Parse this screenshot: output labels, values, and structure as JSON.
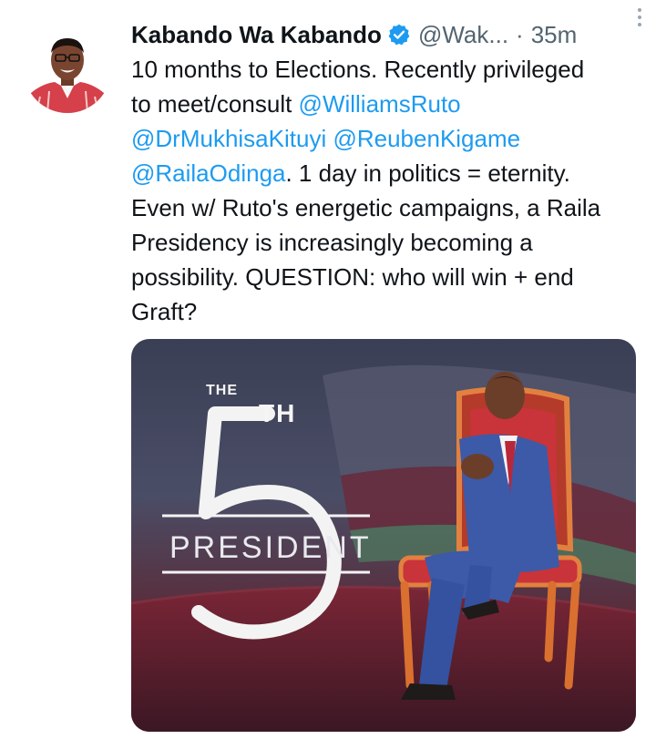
{
  "tweet": {
    "author_name": "Kabando Wa Kabando",
    "handle": "@Wak...",
    "separator": "·",
    "time": "35m",
    "text_lines": [
      {
        "parts": [
          {
            "t": "10 months to Elections. Recently privileged",
            "m": false
          }
        ]
      },
      {
        "parts": [
          {
            "t": "to meet/consult ",
            "m": false
          },
          {
            "t": "@WilliamsRuto",
            "m": true
          }
        ]
      },
      {
        "parts": [
          {
            "t": "@DrMukhisaKituyi",
            "m": true
          },
          {
            "t": "  ",
            "m": false
          },
          {
            "t": "@ReubenKigame",
            "m": true
          }
        ]
      },
      {
        "parts": [
          {
            "t": "@RailaOdinga",
            "m": true
          },
          {
            "t": ". 1 day in politics = eternity.",
            "m": false
          }
        ]
      },
      {
        "parts": [
          {
            "t": "Even w/ Ruto's energetic campaigns, a Raila",
            "m": false
          }
        ]
      },
      {
        "parts": [
          {
            "t": "Presidency is increasingly becoming a",
            "m": false
          }
        ]
      },
      {
        "parts": [
          {
            "t": "possibility. QUESTION: who will win + end",
            "m": false
          }
        ]
      },
      {
        "parts": [
          {
            "t": "Graft?",
            "m": false
          }
        ]
      }
    ]
  },
  "media": {
    "poster_the": "THE",
    "poster_th": "TH",
    "poster_word": "PRESIDENT"
  },
  "icons": {
    "avatar": "avatar-photo",
    "verified": "verified-badge-icon",
    "more": "more-options-icon"
  },
  "colors": {
    "mention": "#1d9bf0",
    "secondary": "#536471",
    "verified": "#1d9bf0"
  }
}
